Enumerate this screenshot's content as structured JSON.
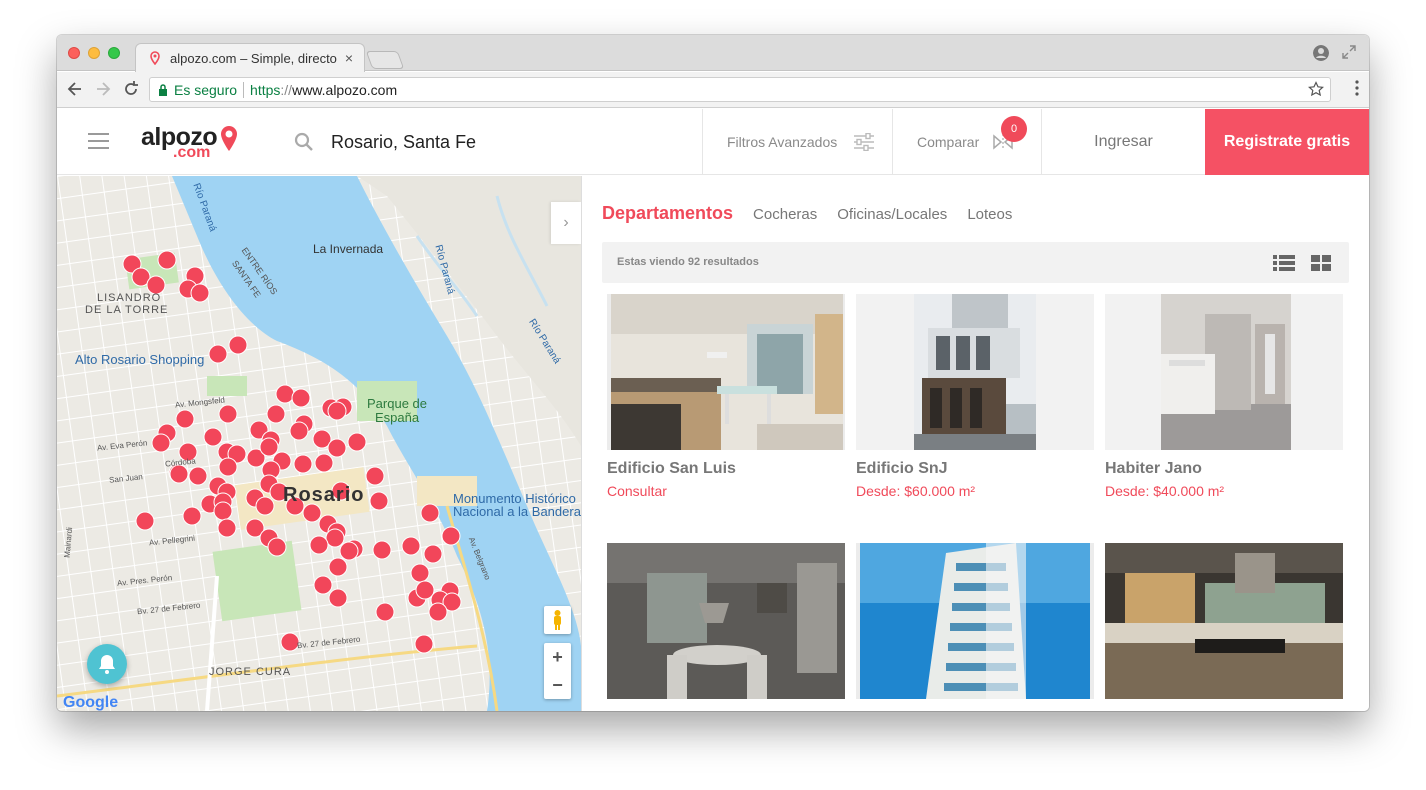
{
  "browser": {
    "tab_title": "alpozo.com – Simple, directo",
    "tab_close": "×",
    "secure_label": "Es seguro",
    "url_scheme": "https",
    "url_slashes": "://",
    "url_host": "www.alpozo.com"
  },
  "header": {
    "logo_main": "alpozo",
    "logo_sub": ".com",
    "location": "Rosario, Santa Fe",
    "filters_label": "Filtros Avanzados",
    "compare_label": "Comparar",
    "compare_count": "0",
    "login_label": "Ingresar",
    "register_label": "Registrate gratis"
  },
  "map": {
    "labels": {
      "la_invernada": "La Invernada",
      "lisandro": "LISANDRO",
      "de_la_torre": "DE LA TORRE",
      "alto_rosario": "Alto Rosario Shopping",
      "parque": "Parque de",
      "espana": "España",
      "rosario": "Rosario",
      "monumento1": "Monumento Histórico",
      "monumento2": "Nacional a la Bandera",
      "jorge_cura": "JORGE CURA",
      "entre_rios": "ENTRE RÍOS",
      "santa_fe": "SANTA FE",
      "rio_parana": "Río Paraná",
      "rio_parana2": "Río Paraná",
      "rio_parana3": "Río Paraná",
      "av_mongsfeld": "Av. Mongsfeld",
      "av_eva_peron": "Av. Eva Perón",
      "cordoba": "Córdoba",
      "san_juan": "San Juan",
      "av_pellegrini": "Av. Pellegrini",
      "av_pres_peron": "Av. Pres. Perón",
      "bv_27_febrero": "Bv. 27 de Febrero",
      "bv_27_febrero2": "Bv. 27 de Febrero",
      "av_belgrano": "Av. Belgrano",
      "mainardi": "Mainardi",
      "google": "Google"
    },
    "zoom_in": "+",
    "zoom_out": "−",
    "collapse": "›"
  },
  "listing": {
    "categories": [
      {
        "label": "Departamentos"
      },
      {
        "label": "Cocheras"
      },
      {
        "label": "Oficinas/Locales"
      },
      {
        "label": "Loteos"
      }
    ],
    "results_text": "Estas viendo 92 resultados",
    "cards": [
      {
        "name": "Edificio San Luis",
        "price": "Consultar"
      },
      {
        "name": "Edificio SnJ",
        "price": "Desde: $60.000 m²"
      },
      {
        "name": "Habiter Jano",
        "price": "Desde: $40.000 m²"
      },
      {
        "name": "",
        "price": ""
      },
      {
        "name": "",
        "price": ""
      },
      {
        "name": "",
        "price": ""
      }
    ]
  },
  "colors": {
    "brand": "#f04a5a",
    "register_bg": "#f55164",
    "marker": "#f2465a",
    "water": "#9fd3f3",
    "park": "#c8e6b8"
  },
  "icons": {
    "search": "search-icon",
    "filters": "sliders-icon",
    "compare": "compare-icon",
    "menu": "hamburger-icon",
    "bell": "bell-icon",
    "list_view": "list-view-icon",
    "grid_view": "grid-view-icon"
  }
}
